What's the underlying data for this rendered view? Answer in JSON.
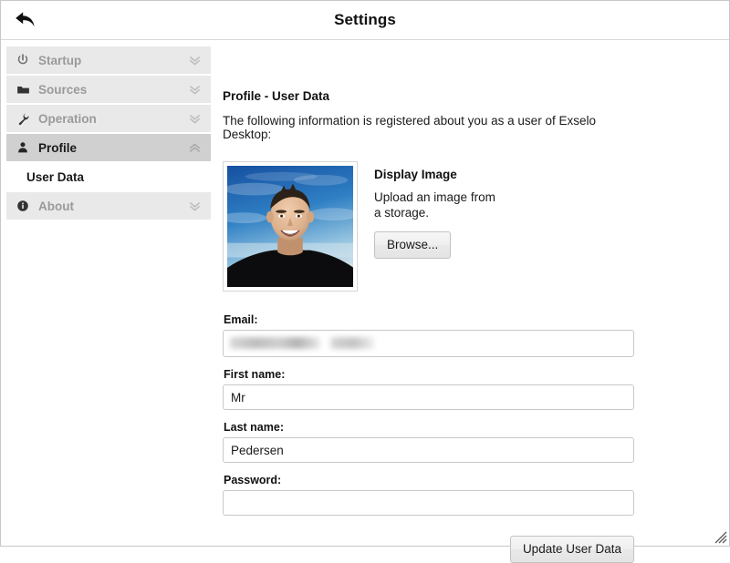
{
  "window": {
    "title": "Settings",
    "back_icon": "back-arrow-icon",
    "resize_grip_icon": "resize-grip-icon"
  },
  "sidebar": {
    "items": [
      {
        "label": "Startup",
        "icon": "power-icon",
        "chevron": "chevron-double-down-icon",
        "active": false
      },
      {
        "label": "Sources",
        "icon": "folder-icon",
        "chevron": "chevron-double-down-icon",
        "active": false
      },
      {
        "label": "Operation",
        "icon": "wrench-icon",
        "chevron": "chevron-double-down-icon",
        "active": false
      },
      {
        "label": "Profile",
        "icon": "person-icon",
        "chevron": "chevron-double-up-icon",
        "active": true
      },
      {
        "label": "About",
        "icon": "info-icon",
        "chevron": "chevron-double-down-icon",
        "active": false
      }
    ],
    "subitems": [
      {
        "label": "User Data",
        "parent": "Profile",
        "selected": true
      }
    ]
  },
  "content": {
    "heading": "Profile - User Data",
    "description": "The following information is registered about you as a user of Exselo Desktop:",
    "display_image": {
      "title": "Display Image",
      "description": "Upload an image from a storage.",
      "browse_label": "Browse...",
      "photo_alt": "user-profile-photo"
    },
    "form": {
      "email": {
        "label": "Email:",
        "value": "",
        "placeholder": "",
        "redacted": true
      },
      "first_name": {
        "label": "First name:",
        "value": "Mr",
        "placeholder": ""
      },
      "last_name": {
        "label": "Last name:",
        "value": "Pedersen",
        "placeholder": ""
      },
      "password": {
        "label": "Password:",
        "value": "",
        "placeholder": ""
      },
      "submit_label": "Update User Data"
    }
  },
  "colors": {
    "nav_bg": "#e9e9e9",
    "nav_bg_active": "#d0d0d0",
    "nav_label": "#9a9a9a",
    "nav_label_active": "#1a1a1a",
    "border": "#c8c8c8",
    "text": "#1a1a1a"
  }
}
